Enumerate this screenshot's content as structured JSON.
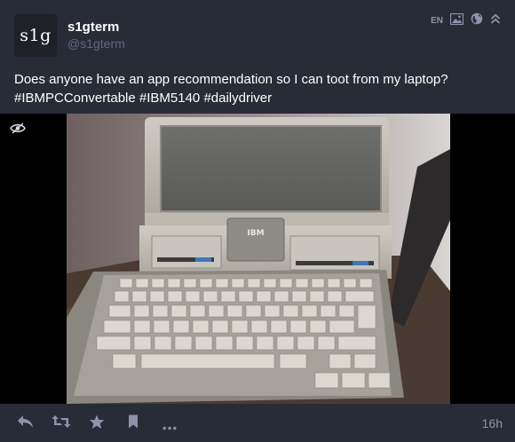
{
  "post": {
    "avatar_text": "s1g",
    "display_name": "s1gterm",
    "handle": "@s1gterm",
    "language": "EN",
    "content": "Does anyone have an app recommendation so I can toot from my laptop? #IBMPCConvertable #IBM5140 #dailydriver",
    "timestamp": "16h"
  },
  "media": {
    "type": "photo",
    "subject": "vintage laptop computer with keyboard and floppy drives",
    "logo_text": "IBM"
  },
  "icons": {
    "media": "image-icon",
    "visibility": "globe-icon",
    "collapse": "chevron-up-double-icon",
    "hide_media": "eye-slash-icon",
    "reply": "reply-icon",
    "boost": "retweet-icon",
    "favourite": "star-icon",
    "bookmark": "bookmark-icon",
    "more": "ellipsis-icon"
  },
  "colors": {
    "background": "#282c37",
    "muted": "#8d93ab",
    "handle": "#606984",
    "text": "#ffffff"
  }
}
